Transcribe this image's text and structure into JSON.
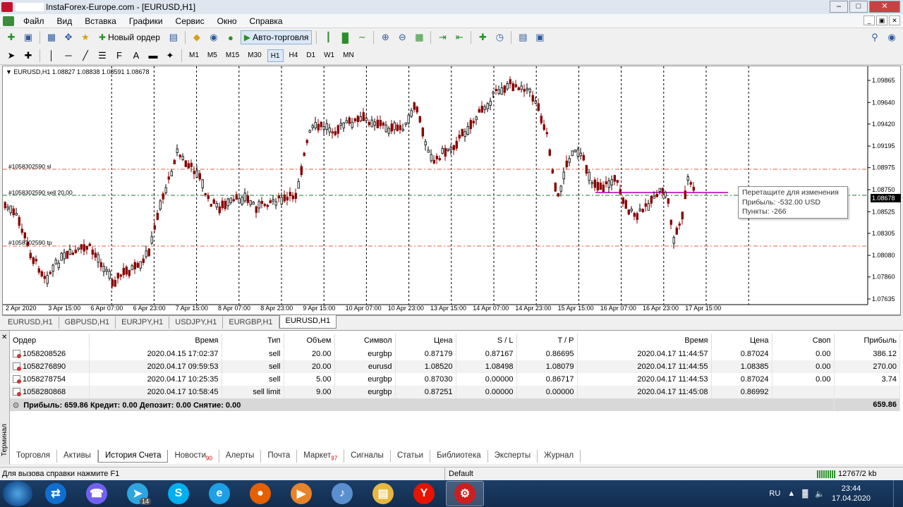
{
  "window": {
    "title": "InstaForex-Europe.com - [EURUSD,H1]",
    "min": "–",
    "max": "□",
    "close": "✕"
  },
  "menu": [
    "Файл",
    "Вид",
    "Вставка",
    "Графики",
    "Сервис",
    "Окно",
    "Справка"
  ],
  "toolbar": {
    "new_order": "Новый ордер",
    "auto_trading": "Авто-торговля"
  },
  "timeframes": [
    "M1",
    "M5",
    "M15",
    "M30",
    "H1",
    "H4",
    "D1",
    "W1",
    "MN"
  ],
  "active_timeframe": "H1",
  "chart": {
    "header": "EURUSD,H1  1.08827 1.08838 1.08591 1.08678",
    "current_price": "1.08678",
    "price_labels": [
      "1.09865",
      "1.09640",
      "1.09420",
      "1.09195",
      "1.08975",
      "1.08750",
      "1.08525",
      "1.08305",
      "1.08080",
      "1.07860",
      "1.07635"
    ],
    "time_labels": [
      "2 Apr 2020",
      "3 Apr 15:00",
      "6 Apr 07:00",
      "6 Apr 23:00",
      "7 Apr 15:00",
      "8 Apr 07:00",
      "8 Apr 23:00",
      "9 Apr 15:00",
      "10 Apr 07:00",
      "10 Apr 23:00",
      "13 Apr 15:00",
      "14 Apr 07:00",
      "14 Apr 23:00",
      "15 Apr 15:00",
      "16 Apr 07:00",
      "16 Apr 23:00",
      "17 Apr 15:00"
    ],
    "levels": {
      "sl": "#1058302590 sl",
      "entry": "#1058302590 sell 20.00",
      "tp": "#1058302590 tp"
    },
    "tooltip": {
      "line1": "Перетащите для изменения",
      "line2": "Прибыль: -532.00 USD",
      "line3": "Пункты: -266"
    },
    "colors": {
      "up": "#000000",
      "down": "#8b0000",
      "level": "#e06040",
      "entry": "#1a7a2a",
      "drag": "#cc33cc"
    }
  },
  "chart_tabs": [
    "EURUSD,H1",
    "GBPUSD,H1",
    "EURJPY,H1",
    "USDJPY,H1",
    "EURGBP,H1",
    "EURUSD,H1"
  ],
  "active_chart_tab": 5,
  "terminal": {
    "headers": [
      "Ордер",
      "Время",
      "Тип",
      "Объем",
      "Символ",
      "Цена",
      "S / L",
      "T / P",
      "Время",
      "Цена",
      "Своп",
      "Прибыль"
    ],
    "rows": [
      [
        "1058208526",
        "2020.04.15 17:02:37",
        "sell",
        "20.00",
        "eurgbp",
        "0.87179",
        "0.87167",
        "0.86695",
        "2020.04.17 11:44:57",
        "0.87024",
        "0.00",
        "386.12"
      ],
      [
        "1058276890",
        "2020.04.17 09:59:53",
        "sell",
        "20.00",
        "eurusd",
        "1.08520",
        "1.08498",
        "1.08079",
        "2020.04.17 11:44:55",
        "1.08385",
        "0.00",
        "270.00"
      ],
      [
        "1058278754",
        "2020.04.17 10:25:35",
        "sell",
        "5.00",
        "eurgbp",
        "0.87030",
        "0.00000",
        "0.86717",
        "2020.04.17 11:44:53",
        "0.87024",
        "0.00",
        "3.74"
      ],
      [
        "1058280868",
        "2020.04.17 10:58:45",
        "sell limit",
        "9.00",
        "eurgbp",
        "0.87251",
        "0.00000",
        "0.00000",
        "2020.04.17 11:45:08",
        "0.86992",
        "",
        ""
      ]
    ],
    "summary": "Прибыль: 659.86  Кредит: 0.00  Депозит: 0.00  Снятие: 0.00",
    "summary_total": "659.86",
    "side_label": "Терминал",
    "tabs": [
      {
        "label": "Торговля",
        "badge": ""
      },
      {
        "label": "Активы",
        "badge": ""
      },
      {
        "label": "История Счета",
        "badge": ""
      },
      {
        "label": "Новости",
        "badge": "90"
      },
      {
        "label": "Алерты",
        "badge": ""
      },
      {
        "label": "Почта",
        "badge": ""
      },
      {
        "label": "Маркет",
        "badge": "97"
      },
      {
        "label": "Сигналы",
        "badge": ""
      },
      {
        "label": "Статьи",
        "badge": ""
      },
      {
        "label": "Библиотека",
        "badge": ""
      },
      {
        "label": "Эксперты",
        "badge": ""
      },
      {
        "label": "Журнал",
        "badge": ""
      }
    ],
    "active_tab": 2
  },
  "status": {
    "help": "Для вызова справки нажмите F1",
    "profile": "Default",
    "traffic": "12767/2 kb"
  },
  "taskbar": {
    "lang": "RU",
    "time": "23:44",
    "date": "17.04.2020",
    "apps": [
      {
        "name": "teamviewer-icon",
        "glyph": "⇄",
        "color": "#0e6fd1",
        "badge": ""
      },
      {
        "name": "viber-icon",
        "glyph": "☎",
        "color": "#7360f2",
        "badge": ""
      },
      {
        "name": "telegram-icon",
        "glyph": "➤",
        "color": "#2ca5e0",
        "badge": "14"
      },
      {
        "name": "skype-icon",
        "glyph": "S",
        "color": "#00aff0",
        "badge": ""
      },
      {
        "name": "ie-icon",
        "glyph": "e",
        "color": "#1ea0e6",
        "badge": ""
      },
      {
        "name": "firefox-icon",
        "glyph": "●",
        "color": "#e66000",
        "badge": ""
      },
      {
        "name": "media-player-icon",
        "glyph": "▶",
        "color": "#e8832a",
        "badge": ""
      },
      {
        "name": "audio-icon",
        "glyph": "♪",
        "color": "#5a8fd0",
        "badge": ""
      },
      {
        "name": "explorer-icon",
        "glyph": "▤",
        "color": "#e7b83f",
        "badge": ""
      },
      {
        "name": "yandex-icon",
        "glyph": "Y",
        "color": "#e61400",
        "badge": ""
      },
      {
        "name": "metatrader-icon",
        "glyph": "⚙",
        "color": "#cc1f1f",
        "badge": ""
      }
    ],
    "active_app": 10
  }
}
